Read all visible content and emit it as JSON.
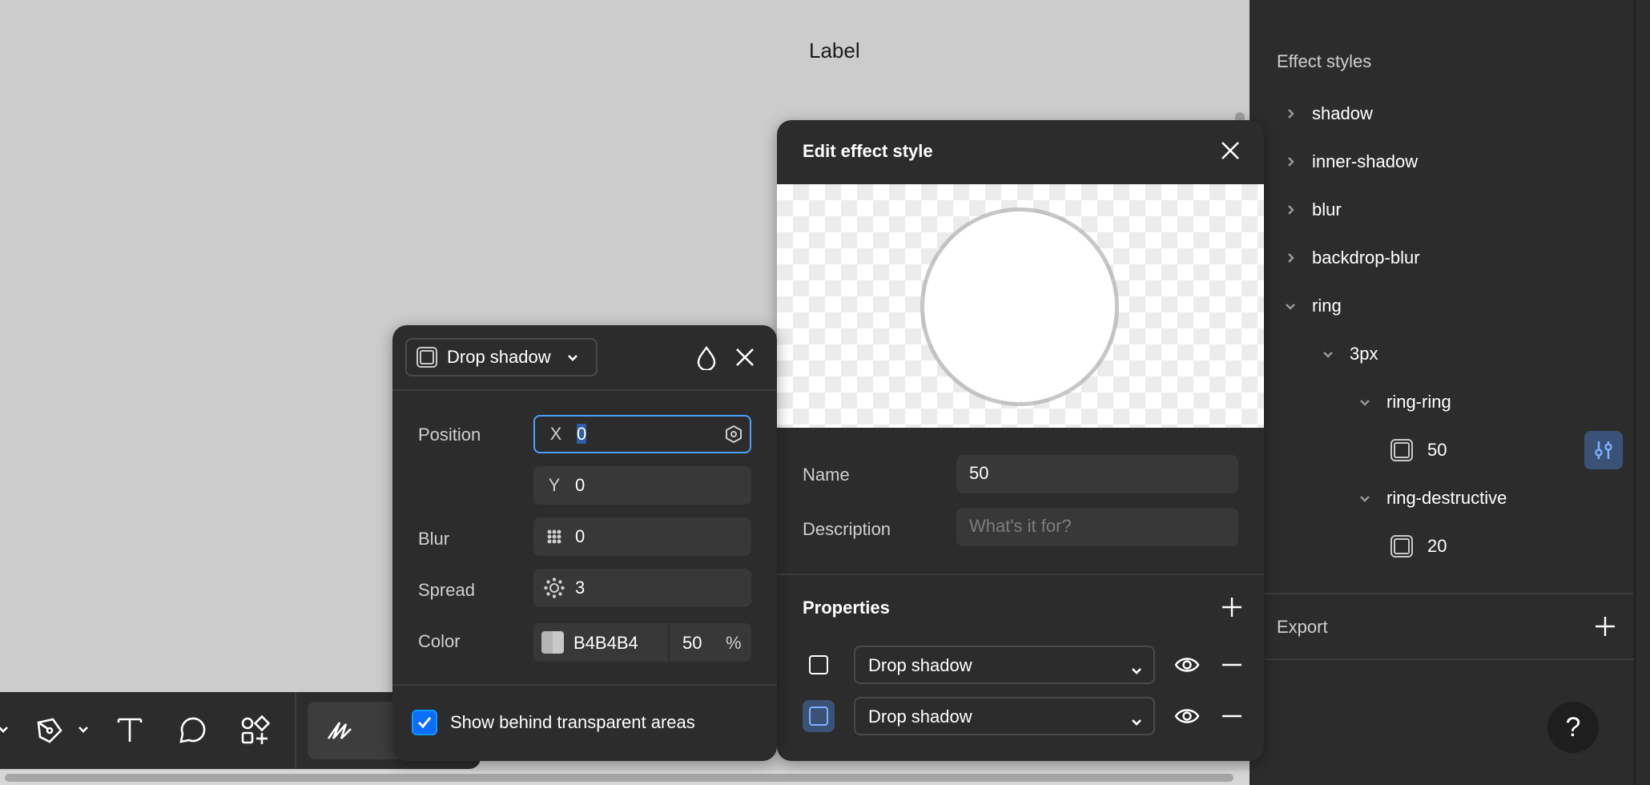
{
  "canvas": {
    "label": "Label"
  },
  "right_panel": {
    "effect_styles_title": "Effect styles",
    "tree": [
      {
        "label": "shadow",
        "expanded": false
      },
      {
        "label": "inner-shadow",
        "expanded": false
      },
      {
        "label": "blur",
        "expanded": false
      },
      {
        "label": "backdrop-blur",
        "expanded": false
      },
      {
        "label": "ring",
        "expanded": true
      },
      {
        "label": "3px",
        "expanded": true
      },
      {
        "label": "ring-ring",
        "expanded": true
      },
      {
        "label": "50"
      },
      {
        "label": "ring-destructive",
        "expanded": true
      },
      {
        "label": "20"
      }
    ],
    "export_title": "Export",
    "help_label": "?"
  },
  "edit_modal": {
    "title": "Edit effect style",
    "name_label": "Name",
    "name_value": "50",
    "description_label": "Description",
    "description_placeholder": "What's it for?",
    "properties_title": "Properties",
    "properties": [
      {
        "type": "Drop shadow",
        "active": false
      },
      {
        "type": "Drop shadow",
        "active": true
      }
    ]
  },
  "drop_panel": {
    "type_label": "Drop shadow",
    "position_label": "Position",
    "x_prefix": "X",
    "x_value": "0",
    "y_prefix": "Y",
    "y_value": "0",
    "blur_label": "Blur",
    "blur_value": "0",
    "spread_label": "Spread",
    "spread_value": "3",
    "color_label": "Color",
    "color_hex": "B4B4B4",
    "color_opacity": "50",
    "percent_sign": "%",
    "show_behind_label": "Show behind transparent areas",
    "show_behind_checked": true
  },
  "colors": {
    "panel_bg": "#2c2c2c",
    "canvas_bg": "#cccccc",
    "accent": "#0d99ff",
    "shadow_color": "#B4B4B4"
  }
}
